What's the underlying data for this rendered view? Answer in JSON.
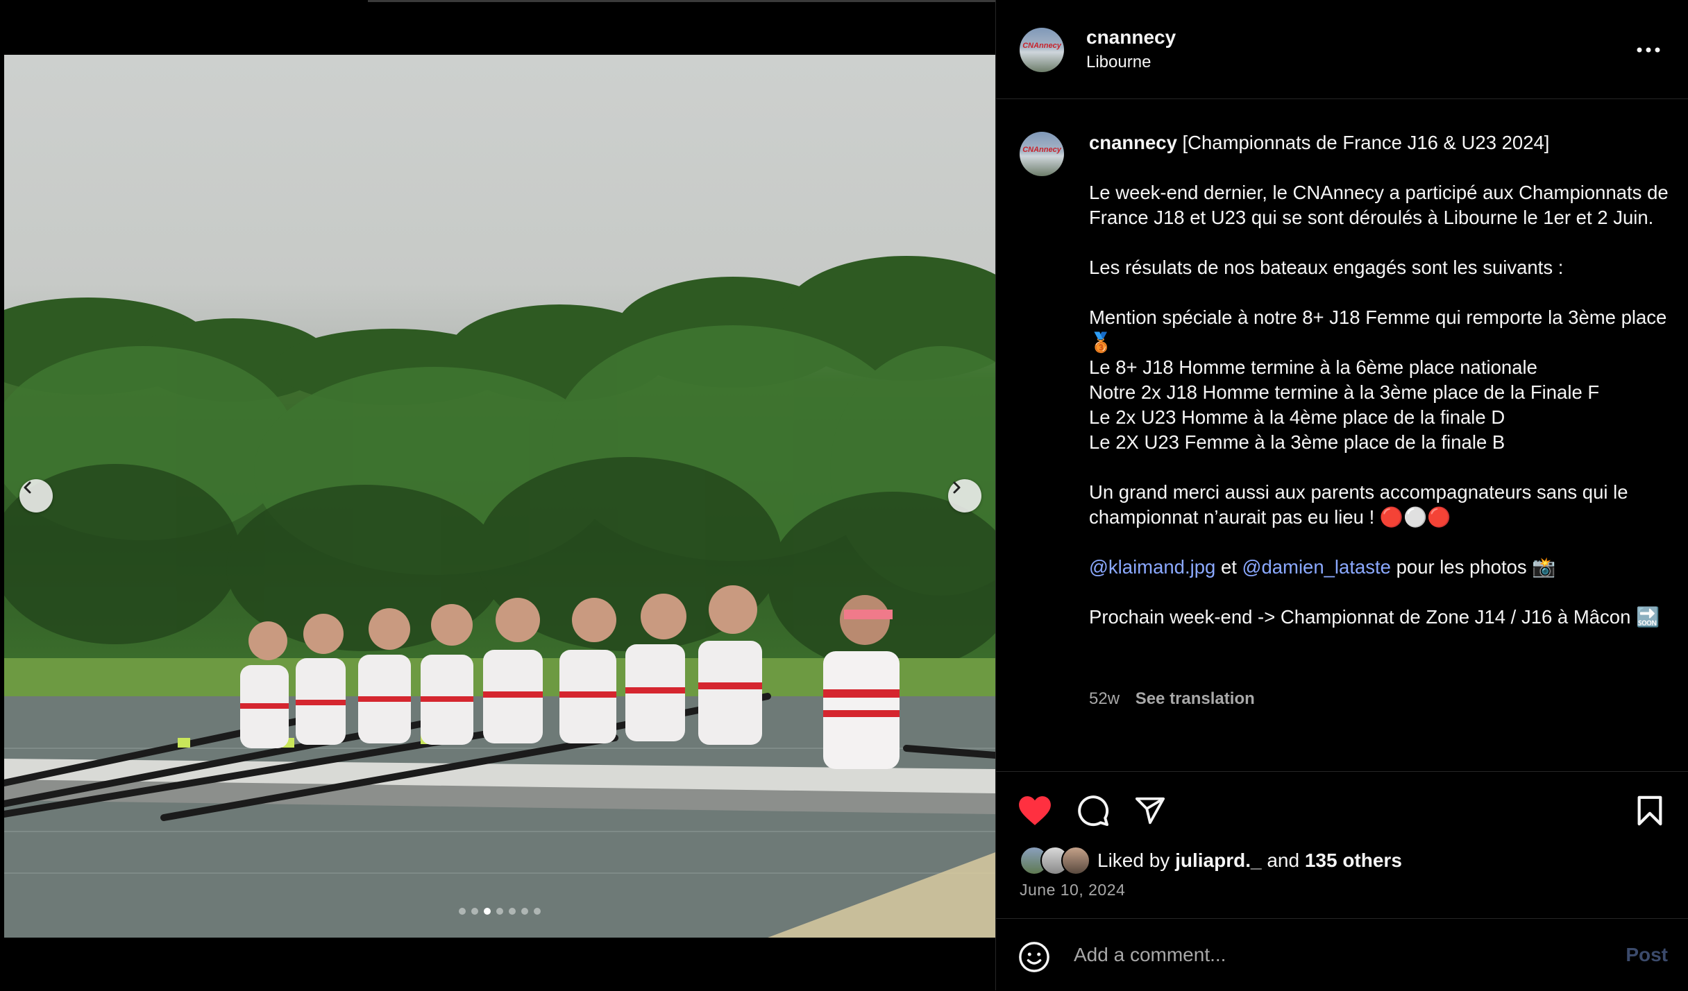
{
  "post": {
    "username": "cnannecy",
    "location": "Libourne",
    "avatar_label": "CNAnnecy",
    "carousel": {
      "total_slides": 7,
      "active_index": 2
    }
  },
  "caption": {
    "username": "cnannecy",
    "title": "[Championnats de France J16 & U23 2024]",
    "para1": "Le week-end dernier, le CNAnnecy a participé aux Championnats de France J18 et U23 qui se sont déroulés à Libourne le 1er et 2 Juin.",
    "para2": "Les résulats de nos bateaux engagés sont les suivants :",
    "results": [
      "Mention spéciale à notre 8+ J18 Femme qui remporte la 3ème place 🥉",
      "Le 8+ J18 Homme termine à la 6ème place nationale",
      "Notre 2x J18 Homme termine à la 3ème place de la Finale F",
      "Le 2x U23 Homme à la 4ème place de la finale D",
      "Le 2X U23 Femme à la 3ème place de la finale B"
    ],
    "thanks": "Un grand merci aussi aux parents accompagnateurs sans qui le championnat n’aurait pas eu lieu ! 🔴⚪🔴",
    "mention1": "@klaimand.jpg",
    "et": "et",
    "mention2": "@damien_lataste",
    "photos_suffix": "pour les photos 📸",
    "next": "Prochain week-end -> Championnat de Zone J14 / J16 à Mâcon 🔜",
    "age": "52w",
    "see_translation": "See translation"
  },
  "engagement": {
    "liked_by_prefix": "Liked by",
    "liked_by_user": "juliaprd._",
    "and": "and",
    "others": "135 others",
    "date": "June 10, 2024"
  },
  "comment": {
    "placeholder": "Add a comment...",
    "post_label": "Post"
  },
  "colors": {
    "like_red": "#ff3040",
    "mention_blue": "#8ba9ff",
    "secondary_text": "#a8a8a8"
  },
  "icons": [
    "chevron-left-icon",
    "chevron-right-icon",
    "more-icon",
    "heart-icon",
    "comment-icon",
    "share-icon",
    "bookmark-icon",
    "emoji-icon"
  ]
}
